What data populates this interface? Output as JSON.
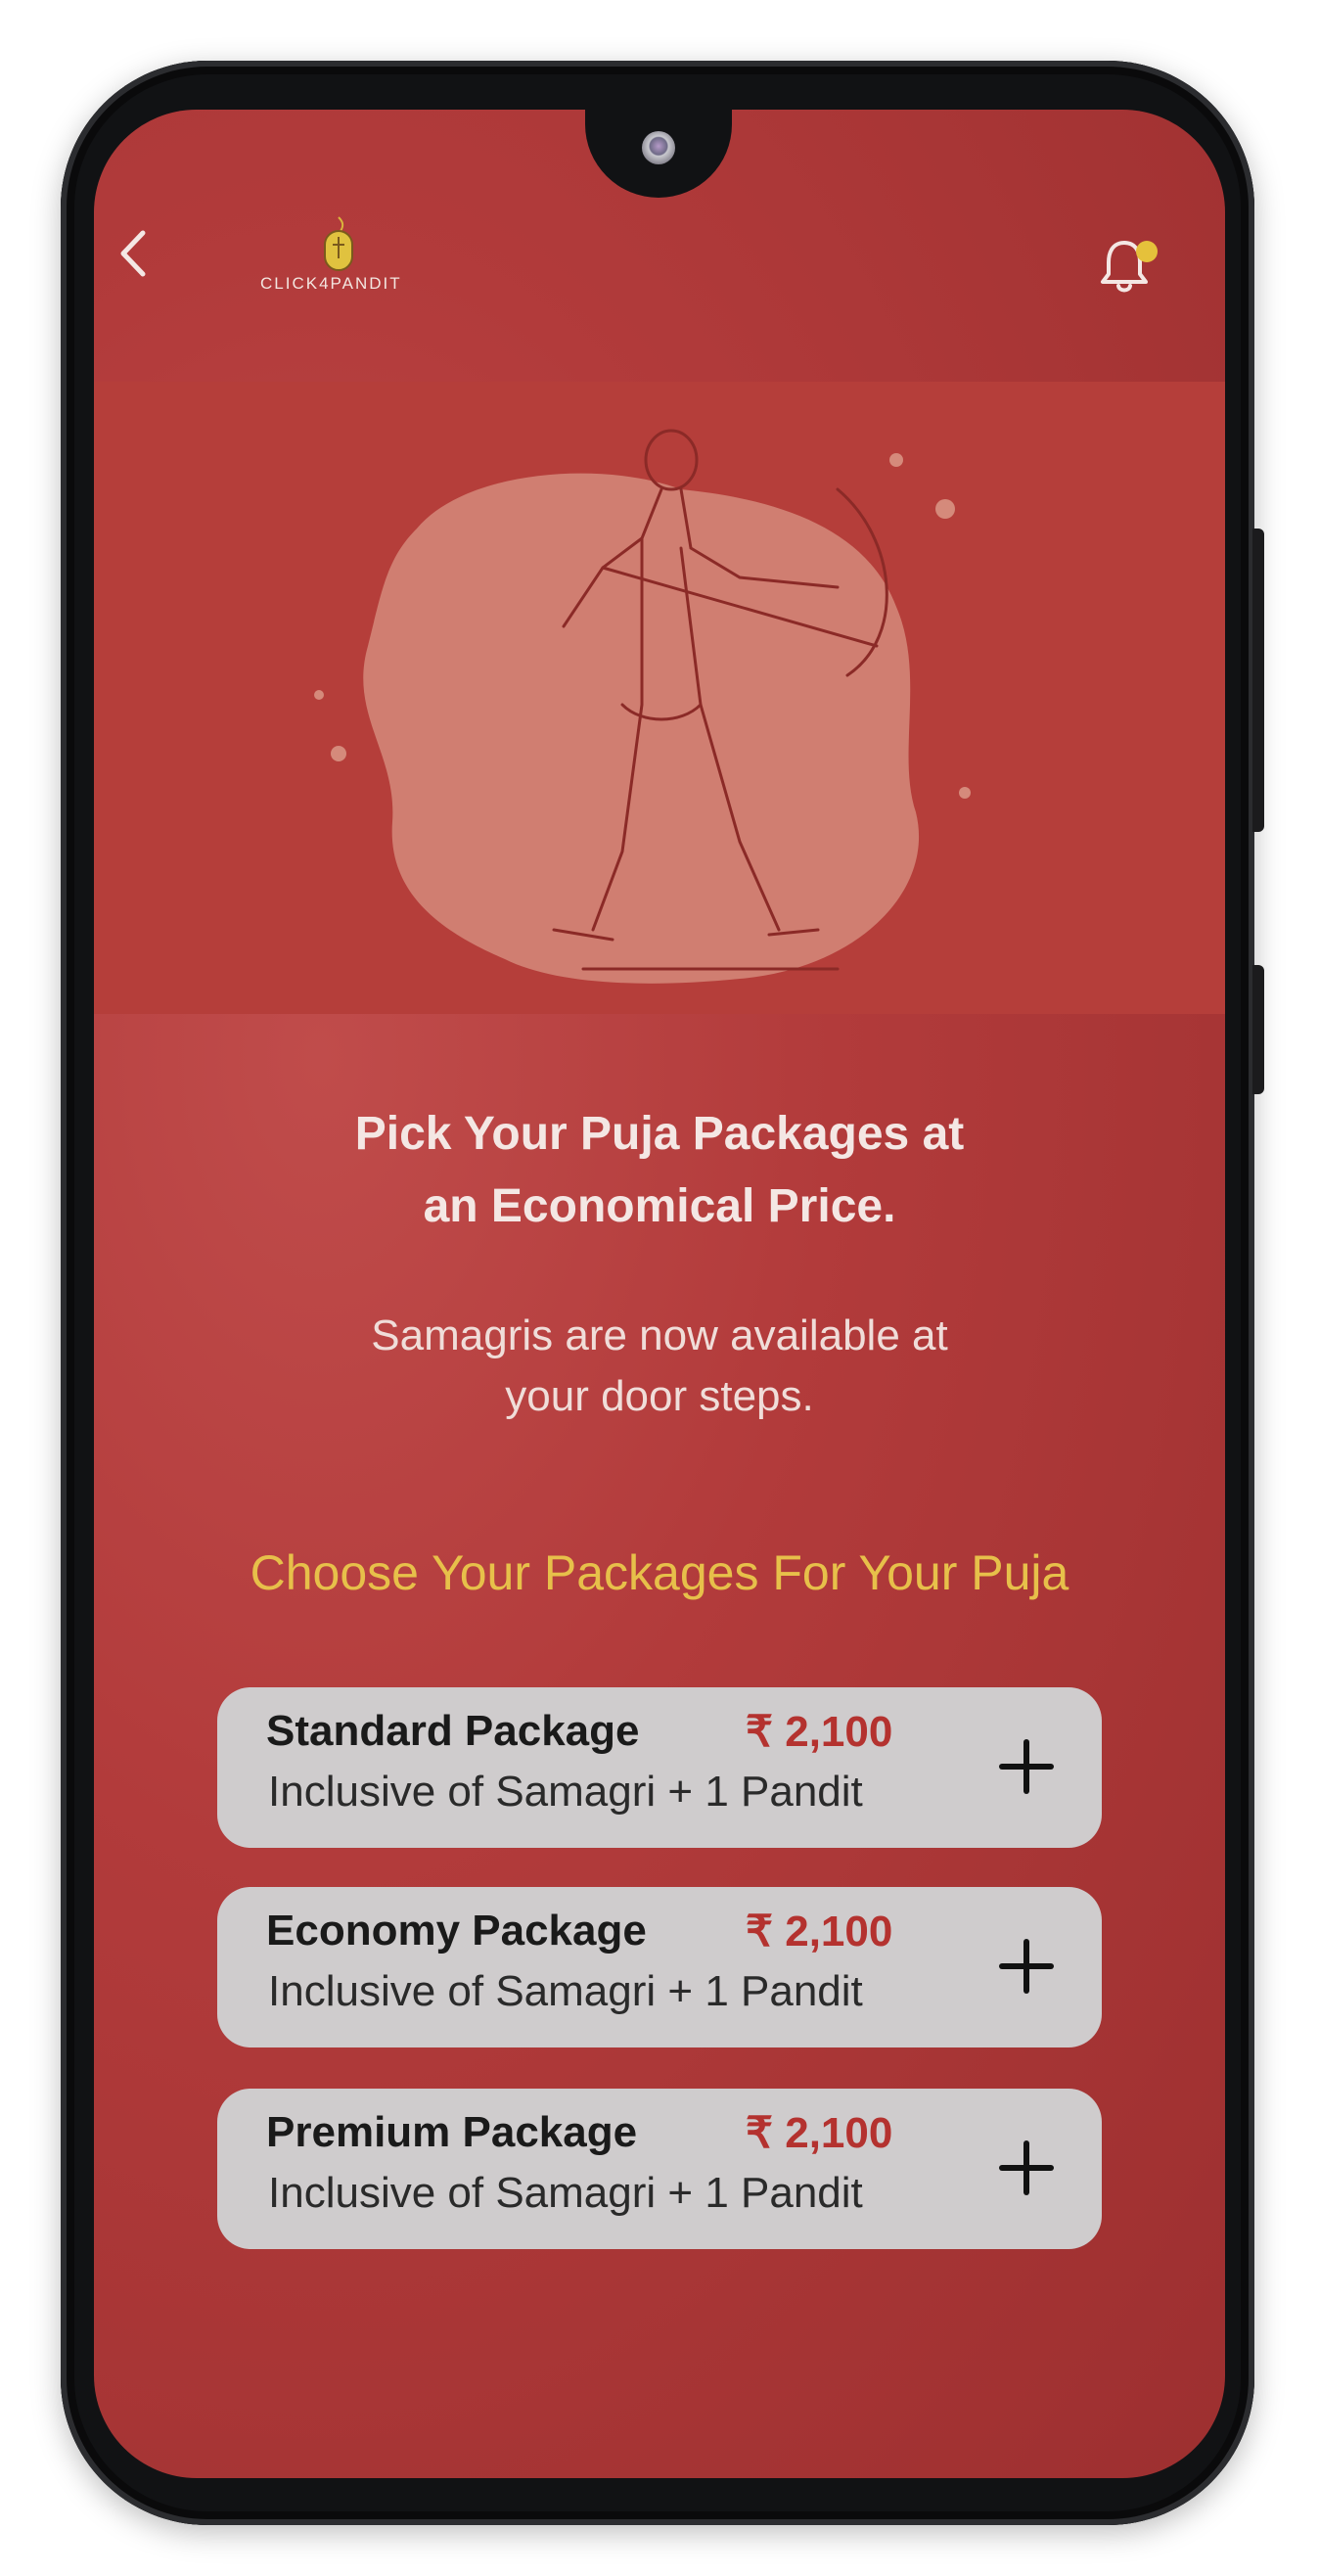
{
  "header": {
    "logo_text": "CLICK4PANDIT",
    "back_icon": "chevron-left-icon",
    "notification_icon": "bell-icon",
    "notification_dot_color": "#e5c13b"
  },
  "hero": {
    "illustration": "archer-deity-sketch"
  },
  "main": {
    "title_line1": "Pick Your Puja Packages at",
    "title_line2": "an Economical Price.",
    "subtitle_line1": "Samagris are now available at",
    "subtitle_line2": "your door steps.",
    "section_title": "Choose Your Packages For Your Puja"
  },
  "packages": [
    {
      "name": "Standard Package",
      "price": "₹ 2,100",
      "description": "Inclusive of Samagri + 1 Pandit",
      "action_icon": "plus-icon"
    },
    {
      "name": "Economy Package",
      "price": "₹ 2,100",
      "description": "Inclusive of Samagri + 1 Pandit",
      "action_icon": "plus-icon"
    },
    {
      "name": "Premium Package",
      "price": "₹ 2,100",
      "description": "Inclusive of Samagri + 1 Pandit",
      "action_icon": "plus-icon"
    }
  ],
  "colors": {
    "background_red": "#b23b3b",
    "accent_gold": "#e7c04a",
    "price_red": "#b4322f",
    "card_gray": "#cfcccd"
  }
}
